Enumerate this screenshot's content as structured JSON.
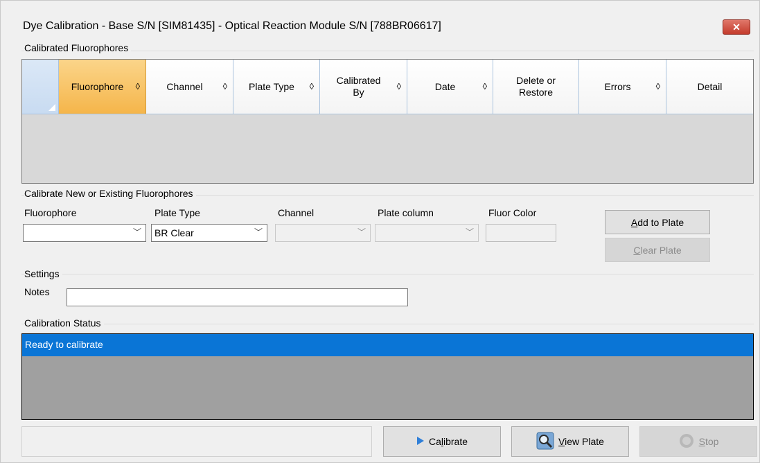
{
  "window": {
    "title": "Dye Calibration - Base S/N [SIM81435] - Optical Reaction Module S/N [788BR06617]",
    "close_label": "✕"
  },
  "calibrated_group": {
    "label": "Calibrated Fluorophores",
    "columns": [
      {
        "label": "Fluorophore",
        "sortable": true,
        "active": true
      },
      {
        "label": "Channel",
        "sortable": true
      },
      {
        "label": "Plate Type",
        "sortable": true
      },
      {
        "label": "Calibrated By",
        "sortable": true
      },
      {
        "label": "Date",
        "sortable": true
      },
      {
        "label": "Delete or Restore",
        "sortable": false
      },
      {
        "label": "Errors",
        "sortable": true
      },
      {
        "label": "Detail",
        "sortable": false
      }
    ],
    "sort_glyph": "◊"
  },
  "calibrate_group": {
    "label": "Calibrate New or Existing Fluorophores",
    "fluorophore_label": "Fluorophore",
    "fluorophore_value": "",
    "plate_type_label": "Plate Type",
    "plate_type_value": "BR Clear",
    "channel_label": "Channel",
    "channel_value": "",
    "plate_column_label": "Plate column",
    "plate_column_value": "",
    "fluor_color_label": "Fluor Color",
    "add_to_plate": {
      "prefix": "",
      "accel": "A",
      "rest": "dd to Plate"
    },
    "clear_plate": {
      "prefix": "",
      "accel": "C",
      "rest": "lear Plate"
    }
  },
  "settings_group": {
    "label": "Settings",
    "notes_label": "Notes",
    "notes_value": ""
  },
  "status_group": {
    "label": "Calibration Status",
    "message": "Ready to calibrate"
  },
  "footer": {
    "calibrate": {
      "prefix": "Ca",
      "accel": "l",
      "rest": "ibrate"
    },
    "view_plate": {
      "prefix": "",
      "accel": "V",
      "rest": "iew Plate"
    },
    "stop": {
      "prefix": "",
      "accel": "S",
      "rest": "top"
    }
  },
  "colors": {
    "accent": "#0a75d6",
    "active_column": "#f5b54a",
    "close_button": "#c43b2c"
  },
  "icons": {
    "calibrate": "play-arrow-icon",
    "view_plate": "magnifier-icon",
    "stop": "stop-icon",
    "close": "close-icon"
  }
}
